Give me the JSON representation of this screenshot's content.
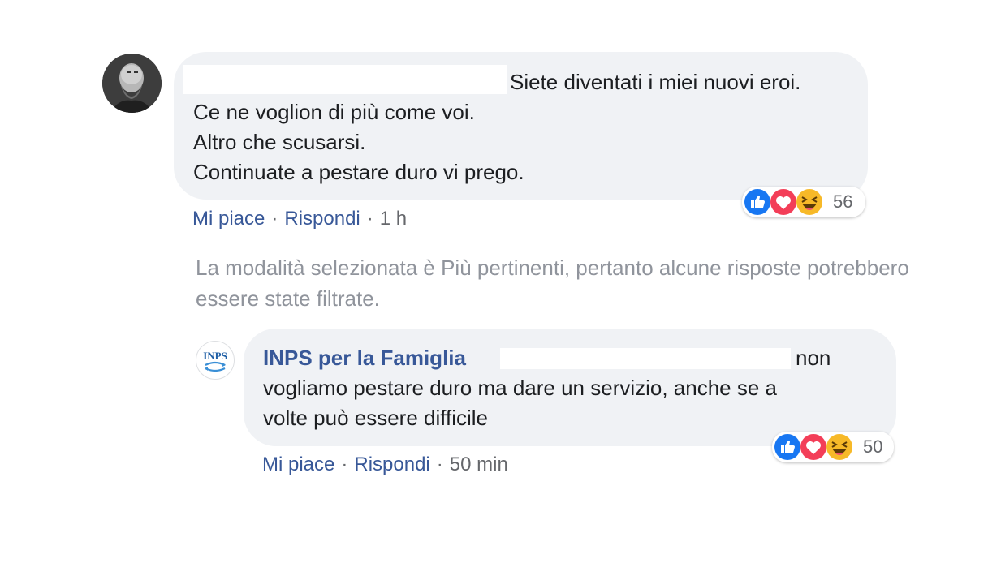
{
  "comments": [
    {
      "author_redacted": true,
      "text_line_1": "Siete diventati i miei nuovi eroi.",
      "text_line_2": "Ce ne voglion di più come voi.",
      "text_line_3": "Altro che scusarsi.",
      "text_line_4": "Continuate a pestare duro vi prego.",
      "reactions": {
        "icons": [
          "like-icon",
          "love-icon",
          "haha-icon"
        ],
        "count": "56"
      },
      "actions": {
        "like": "Mi piace",
        "reply": "Rispondi",
        "time": "1 h",
        "separator": "·"
      }
    }
  ],
  "filter_note": "La modalità selezionata è Più pertinenti, pertanto alcune risposte potrebbero essere state filtrate.",
  "reply": {
    "author": "INPS per la Famiglia",
    "logo_text": "INPS",
    "text_line_1_end": "non",
    "text_line_2": "vogliamo pestare duro ma dare un servizio, anche se a",
    "text_line_3": "volte può essere difficile",
    "reactions": {
      "icons": [
        "like-icon",
        "love-icon",
        "haha-icon"
      ],
      "count": "50"
    },
    "actions": {
      "like": "Mi piace",
      "reply": "Rispondi",
      "time": "50 min",
      "separator": "·"
    }
  },
  "colors": {
    "bubble_bg": "#f0f2f5",
    "link": "#385898",
    "meta": "#65676b",
    "note": "#90949c",
    "like_blue": "#1877f2",
    "love_red": "#f33e58",
    "haha_yellow": "#f7b928"
  }
}
